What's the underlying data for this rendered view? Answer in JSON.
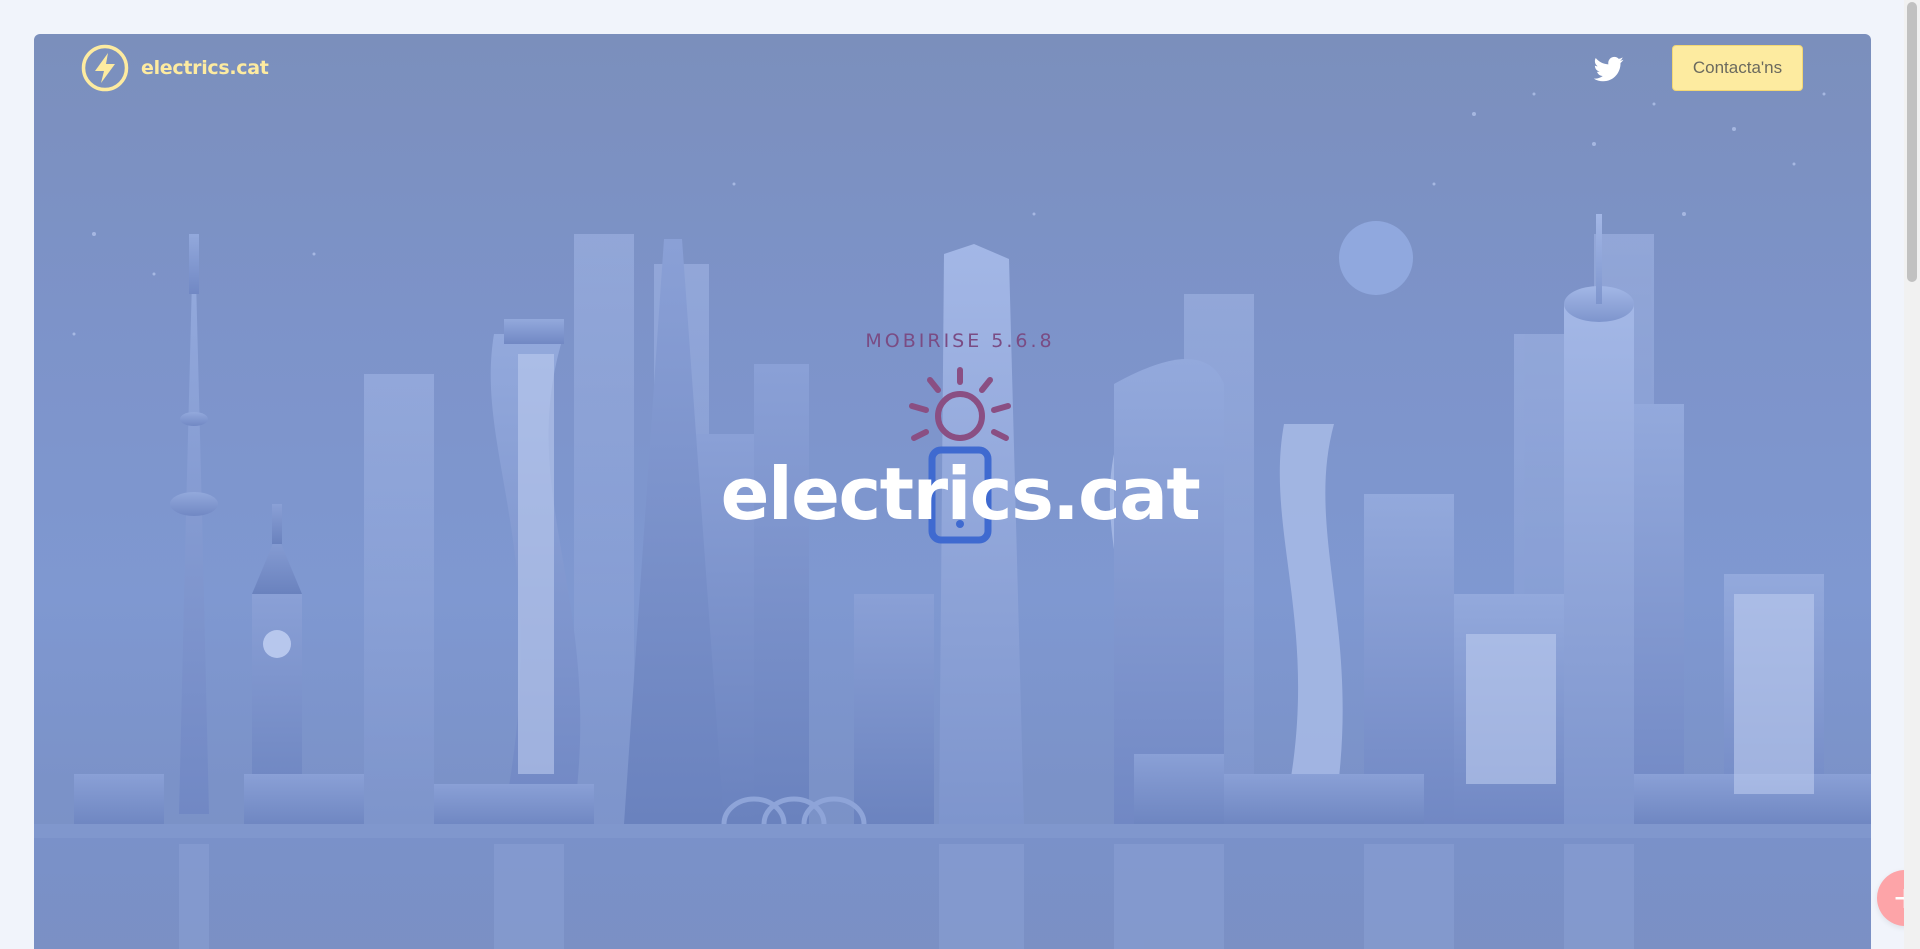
{
  "navbar": {
    "brand_name": "electrics.cat",
    "logo_icon": "lightning-bolt-icon",
    "social_icon": "twitter-icon",
    "contact_label": "Contacta'ns"
  },
  "hero": {
    "subtitle": "MOBIRISE  5.6.8",
    "title": "electrics.cat",
    "illustration": "city-skyline",
    "icon": "smart-bulb-icon"
  },
  "fab": {
    "label": "+",
    "icon": "plus-icon"
  },
  "colors": {
    "brand_yellow": "#fdeba0",
    "hero_blue": "#7f98d1",
    "subtitle_purple": "#7a4c84",
    "fab_pink": "#fda4a8"
  }
}
